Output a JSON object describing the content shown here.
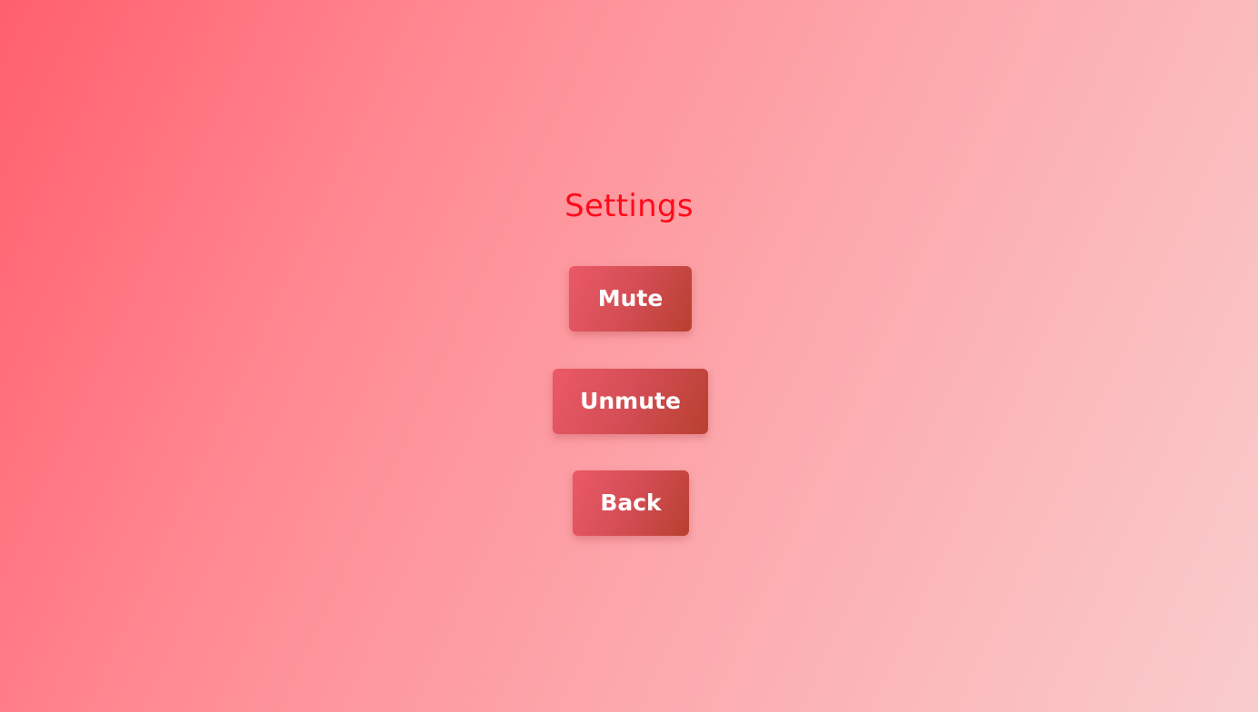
{
  "settings": {
    "title": "Settings",
    "buttons": {
      "mute": "Mute",
      "unmute": "Unmute",
      "back": "Back"
    }
  },
  "colors": {
    "title": "#ff0a1a",
    "button_start": "#ea5a66",
    "button_end": "#b8402f",
    "button_text": "#ffffff",
    "background_start": "#ff5f6d",
    "background_end": "#f9cccc"
  }
}
